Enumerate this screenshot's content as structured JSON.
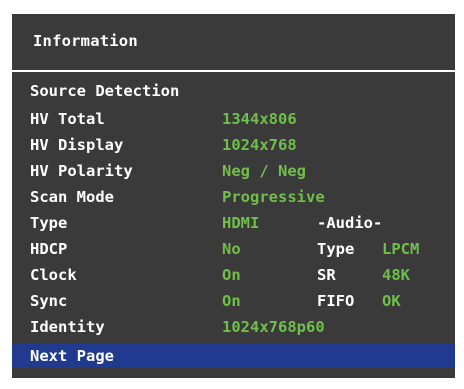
{
  "title": "Information",
  "section_heading": "Source Detection",
  "rows": [
    {
      "label": "HV Total",
      "value": "1344x806"
    },
    {
      "label": "HV Display",
      "value": "1024x768"
    },
    {
      "label": "HV Polarity",
      "value": "Neg / Neg"
    },
    {
      "label": "Scan Mode",
      "value": "Progressive"
    },
    {
      "label": "Type",
      "value": "HDMI",
      "audio_heading": "-Audio-"
    },
    {
      "label": "HDCP",
      "value": "No",
      "audio_label": "Type",
      "audio_value": "LPCM"
    },
    {
      "label": "Clock",
      "value": "On",
      "audio_label": "SR",
      "audio_value": "48K"
    },
    {
      "label": "Sync",
      "value": "On",
      "audio_label": "FIFO",
      "audio_value": "OK"
    },
    {
      "label": "Identity",
      "value": "1024x768p60"
    }
  ],
  "next_page_label": "Next Page",
  "colors": {
    "panel_background": "#3a3a3a",
    "label_text": "#ffffff",
    "value_text": "#6fbf4a",
    "selection_highlight": "#1f3a8f"
  }
}
